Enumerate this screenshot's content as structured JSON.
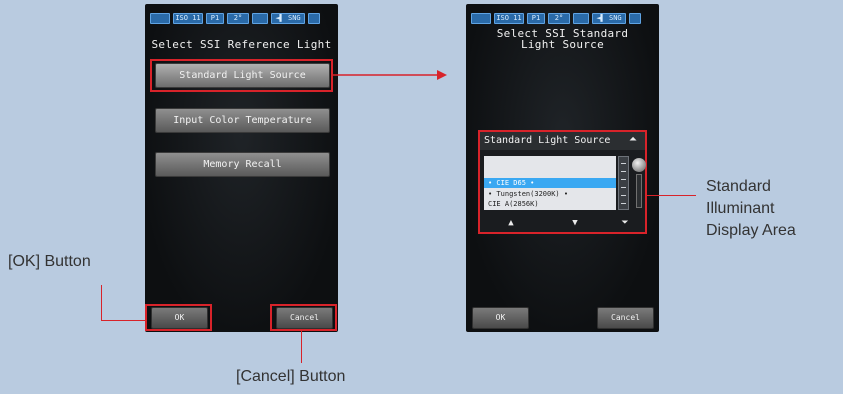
{
  "left_screen": {
    "status_segments": [
      "▬▬",
      "ISO 11",
      "P1",
      "2°",
      "",
      "◄▌ SNG",
      "▪"
    ],
    "title": "Select SSI Reference Light",
    "menu": {
      "standard_light_source": "Standard Light Source",
      "input_color_temperature": "Input Color Temperature",
      "memory_recall": "Memory Recall"
    },
    "ok_label": "OK",
    "cancel_label": "Cancel"
  },
  "right_screen": {
    "status_segments": [
      "▬▬",
      "ISO 11",
      "P1",
      "2°",
      "",
      "◄▌ SNG",
      "▪"
    ],
    "title_line1": "Select SSI Standard",
    "title_line2": "Light Source",
    "panel_title": "Standard Light Source",
    "list_items": [
      "",
      "",
      "• CIE D65 •",
      "• Tungsten(3200K) •",
      "CIE A(2856K)"
    ],
    "selected_index": 2,
    "ok_label": "OK",
    "cancel_label": "Cancel"
  },
  "callouts": {
    "ok_button": "[OK] Button",
    "cancel_button": "[Cancel] Button",
    "illuminant_line1": "Standard",
    "illuminant_line2": "Illuminant",
    "illuminant_line3": "Display Area"
  },
  "colors": {
    "highlight": "#d8232a",
    "screen_bg": "#0d0f11",
    "page_bg": "#b9cbe0",
    "selection": "#3aa8f2"
  }
}
